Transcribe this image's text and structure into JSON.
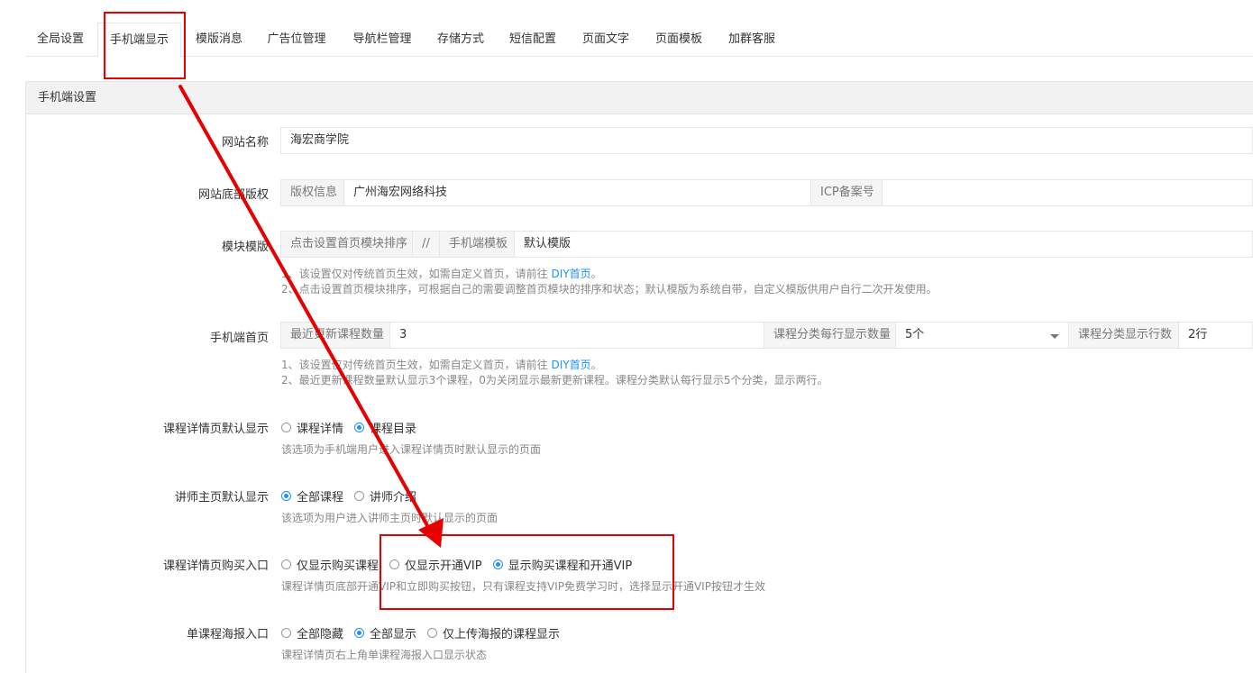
{
  "tabs": [
    {
      "label": "全局设置"
    },
    {
      "label": "手机端显示"
    },
    {
      "label": "模版消息"
    },
    {
      "label": "广告位管理"
    },
    {
      "label": "导航栏管理"
    },
    {
      "label": "存储方式"
    },
    {
      "label": "短信配置"
    },
    {
      "label": "页面文字"
    },
    {
      "label": "页面模板"
    },
    {
      "label": "加群客服"
    }
  ],
  "panel": {
    "title": "手机端设置"
  },
  "site_name": {
    "label": "网站名称",
    "value": "海宏商学院"
  },
  "footer": {
    "label": "网站底部版权",
    "copyright_addon": "版权信息",
    "copyright_value": "广州海宏网络科技",
    "icp_addon": "ICP备案号",
    "icp_value": ""
  },
  "module": {
    "label": "模块模版",
    "sort_addon": "点击设置首页模块排序",
    "sep": "//",
    "template_addon": "手机端模板",
    "template_value": "默认模版",
    "help1_prefix": "1、该设置仅对传统首页生效，如需自定义首页，请前往 ",
    "help1_link": "DIY首页",
    "help1_suffix": "。",
    "help2": "2、点击设置首页模块排序，可根据自己的需要调整首页模块的排序和状态；默认模版为系统自带，自定义模版供用户自行二次开发使用。"
  },
  "home": {
    "label": "手机端首页",
    "recent_addon": "最近更新课程数量",
    "recent_value": "3",
    "per_row_addon": "课程分类每行显示数量",
    "per_row_value": "5个",
    "rows_addon": "课程分类显示行数",
    "rows_value": "2行",
    "help1_prefix": "1、该设置仅对传统首页生效，如需自定义首页，请前往 ",
    "help1_link": "DIY首页",
    "help1_suffix": "。",
    "help2": "2、最近更新课程数量默认显示3个课程，0为关闭显示最新更新课程。课程分类默认每行显示5个分类，显示两行。"
  },
  "detail_default": {
    "label": "课程详情页默认显示",
    "options": [
      "课程详情",
      "课程目录"
    ],
    "selected": 1,
    "help": "该选项为手机端用户进入课程详情页时默认显示的页面"
  },
  "teacher_default": {
    "label": "讲师主页默认显示",
    "options": [
      "全部课程",
      "讲师介绍"
    ],
    "selected": 0,
    "help": "该选项为用户进入讲师主页时默认显示的页面"
  },
  "buy_entry": {
    "label": "课程详情页购买入口",
    "options": [
      "仅显示购买课程",
      "仅显示开通VIP",
      "显示购买课程和开通VIP"
    ],
    "selected": 2,
    "help": "课程详情页底部开通VIP和立即购买按钮，只有课程支持VIP免费学习时，选择显示开通VIP按钮才生效"
  },
  "poster_entry": {
    "label": "单课程海报入口",
    "options": [
      "全部隐藏",
      "全部显示",
      "仅上传海报的课程显示"
    ],
    "selected": 1,
    "help": "课程详情页右上角单课程海报入口显示状态"
  },
  "colors": {
    "accent": "#1e90ff",
    "annotation": "#e60000"
  }
}
